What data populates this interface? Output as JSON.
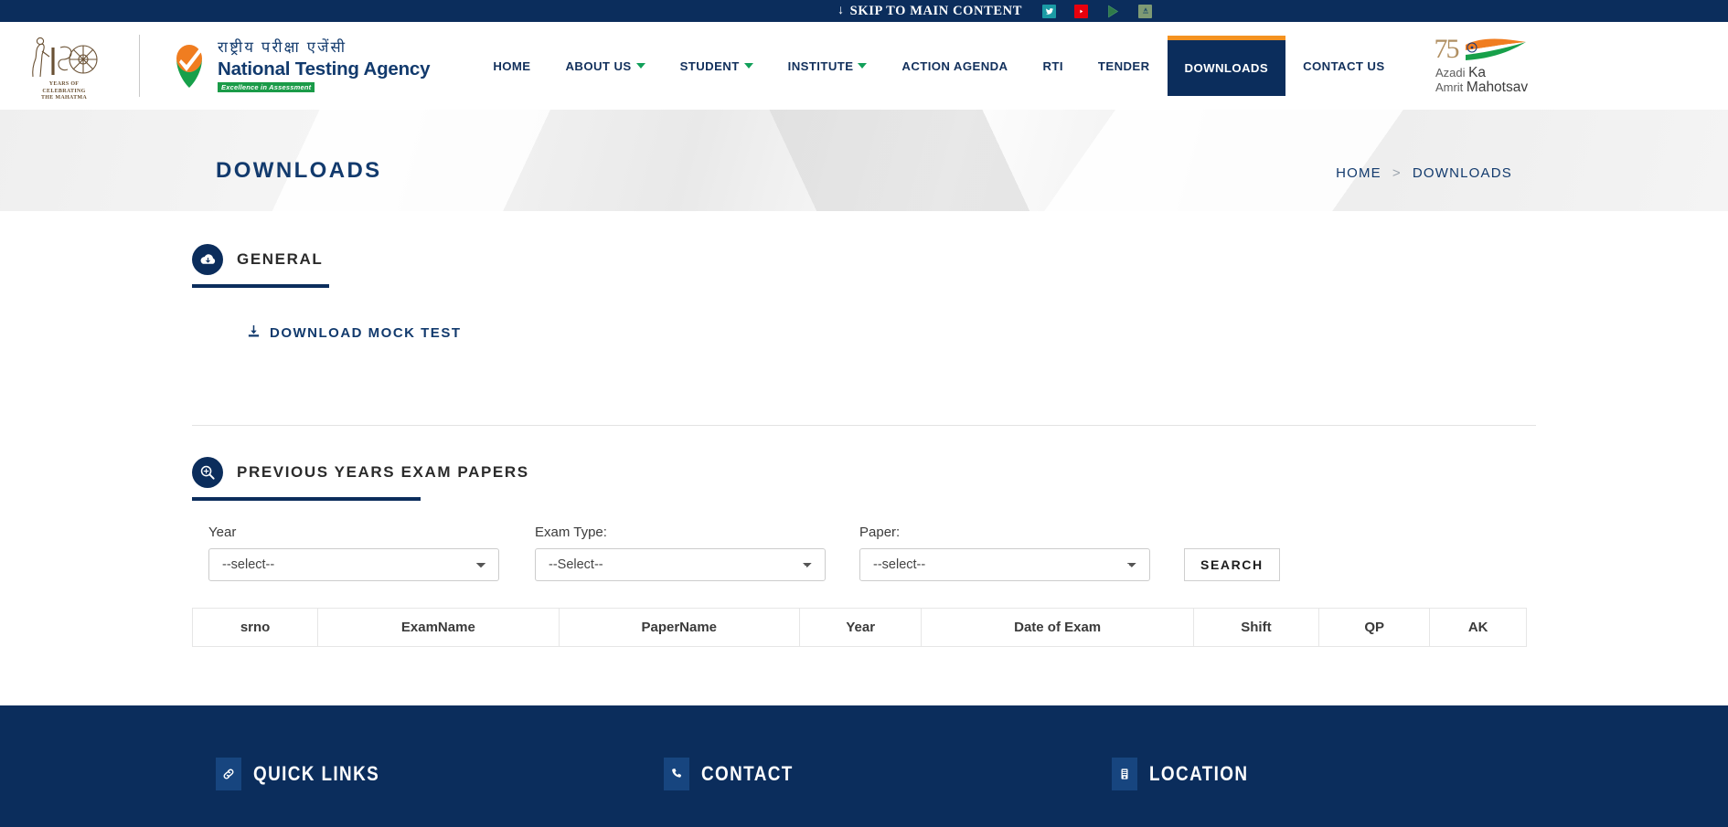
{
  "topbar": {
    "skip_label": "SKIP TO MAIN CONTENT",
    "skip_arrow": "↓",
    "social": [
      {
        "name": "twitter-icon",
        "label": "Twitter",
        "color": "#1b9ba5"
      },
      {
        "name": "youtube-icon",
        "label": "YouTube",
        "color": "#e8000d"
      },
      {
        "name": "google-play-icon",
        "label": "Google Play",
        "color": "#2f7a4a"
      },
      {
        "name": "app-store-icon",
        "label": "App",
        "color": "#7e9a74"
      }
    ]
  },
  "header": {
    "logo_150": {
      "numeral": "150",
      "line1": "YEARS OF",
      "line2": "CELEBRATING",
      "line3": "THE MAHATMA"
    },
    "nta": {
      "hindi": "राष्ट्रीय परीक्षा एजेंसी",
      "english": "National Testing Agency",
      "tagline": "Excellence in Assessment"
    },
    "azadi": {
      "numeral": "75",
      "word1": "Azadi",
      "word1b": "Ka",
      "word2": "Amrit",
      "word2b": "Mahotsav"
    }
  },
  "nav": {
    "items": [
      {
        "label": "HOME",
        "has_caret": false,
        "active": false
      },
      {
        "label": "ABOUT US",
        "has_caret": true,
        "active": false
      },
      {
        "label": "STUDENT",
        "has_caret": true,
        "active": false
      },
      {
        "label": "INSTITUTE",
        "has_caret": true,
        "active": false
      },
      {
        "label": "ACTION AGENDA",
        "has_caret": false,
        "active": false
      },
      {
        "label": "RTI",
        "has_caret": false,
        "active": false
      },
      {
        "label": "TENDER",
        "has_caret": false,
        "active": false
      },
      {
        "label": "DOWNLOADS",
        "has_caret": false,
        "active": true
      },
      {
        "label": "CONTACT US",
        "has_caret": false,
        "active": false
      }
    ],
    "active_bg": "#0b2d5c",
    "active_top_border": "#f49220"
  },
  "banner": {
    "title": "DOWNLOADS",
    "breadcrumb": {
      "home": "HOME",
      "separator": ">",
      "current": "DOWNLOADS"
    }
  },
  "general_section": {
    "icon": "cloud-download-icon",
    "title": "GENERAL",
    "mock_test_link": "DOWNLOAD MOCK TEST",
    "mock_test_icon": "download-icon"
  },
  "previous_papers": {
    "icon": "search-zoom-icon",
    "title": "PREVIOUS YEARS EXAM PAPERS",
    "filters": [
      {
        "label": "Year",
        "value": "--select--",
        "options": [
          "--select--"
        ]
      },
      {
        "label": "Exam Type:",
        "value": "--Select--",
        "options": [
          "--Select--"
        ]
      },
      {
        "label": "Paper:",
        "value": "--select--",
        "options": [
          "--select--"
        ]
      }
    ],
    "search_button": "SEARCH",
    "table": {
      "columns": [
        "srno",
        "ExamName",
        "PaperName",
        "Year",
        "Date of Exam",
        "Shift",
        "QP",
        "AK"
      ],
      "rows": []
    }
  },
  "footer": {
    "columns": [
      {
        "icon": "link-icon",
        "title": "QUICK LINKS"
      },
      {
        "icon": "phone-icon",
        "title": "CONTACT"
      },
      {
        "icon": "building-icon",
        "title": "LOCATION"
      }
    ],
    "background": "#0b2d5c"
  }
}
